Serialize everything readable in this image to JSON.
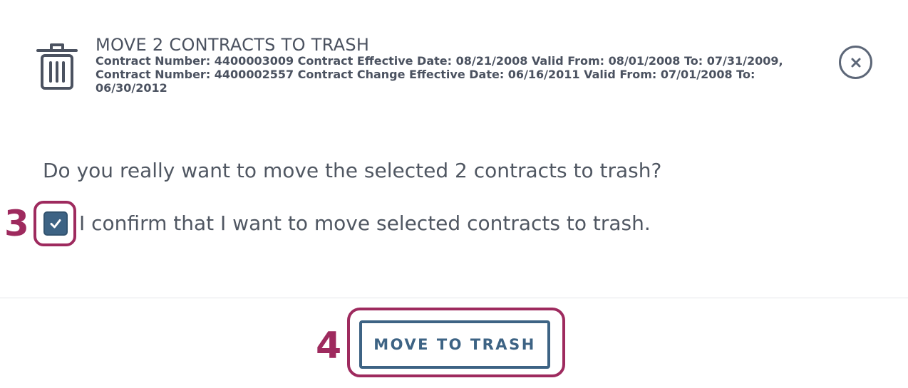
{
  "dialog": {
    "title": "MOVE 2 CONTRACTS TO TRASH",
    "details": "Contract Number: 4400003009 Contract Effective Date: 08/21/2008 Valid From: 08/01/2008 To: 07/31/2009, Contract Number: 4400002557 Contract Change Effective Date: 06/16/2011 Valid From: 07/01/2008 To: 06/30/2012",
    "header_icon": "trash-icon",
    "close_icon": "close-icon"
  },
  "body": {
    "question": "Do you really want to move the selected 2 contracts to trash?",
    "confirm_checkbox": {
      "checked": true,
      "label": "I confirm that I want to move selected contracts to trash."
    }
  },
  "footer": {
    "move_button_label": "MOVE TO TRASH"
  },
  "annotations": {
    "step_3": "3",
    "step_4": "4",
    "highlight_color": "#9e2a5e"
  },
  "colors": {
    "primary": "#3d6384",
    "text": "#505762",
    "highlight": "#9e2a5e"
  }
}
